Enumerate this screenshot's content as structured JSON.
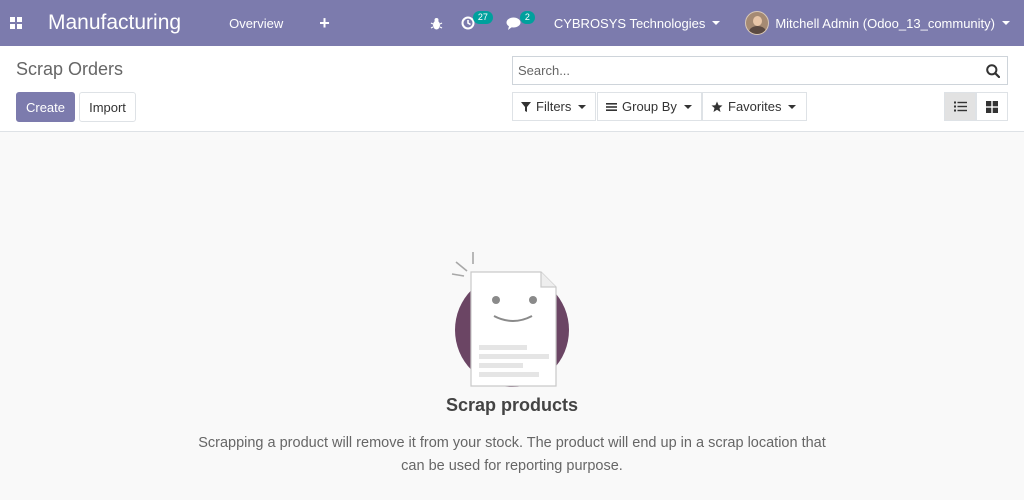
{
  "navbar": {
    "app_name": "Manufacturing",
    "overview_label": "Overview",
    "new_symbol": "+",
    "activity_count": "27",
    "message_count": "2",
    "company": "CYBROSYS Technologies",
    "user": "Mitchell Admin (Odoo_13_community)",
    "bg_color": "#7c7bad"
  },
  "control_panel": {
    "title": "Scrap Orders",
    "create_label": "Create",
    "import_label": "Import",
    "search_placeholder": "Search...",
    "filters_label": "Filters",
    "group_by_label": "Group By",
    "favorites_label": "Favorites",
    "active_view": "list"
  },
  "empty_state": {
    "title": "Scrap products",
    "text": "Scrapping a product will remove it from your stock. The product will end up in a scrap location that can be used for reporting purpose."
  },
  "icons": [
    "apps-grid-icon",
    "bug-icon",
    "activity-clock-icon",
    "chat-bubble-icon",
    "search-icon",
    "filter-funnel-icon",
    "list-lines-icon",
    "star-icon",
    "list-view-icon",
    "kanban-view-icon",
    "smiling-document-icon"
  ],
  "colors": {
    "primary": "#7c7bad",
    "badge": "#00a09d",
    "illustration_circle": "#6b4564"
  }
}
